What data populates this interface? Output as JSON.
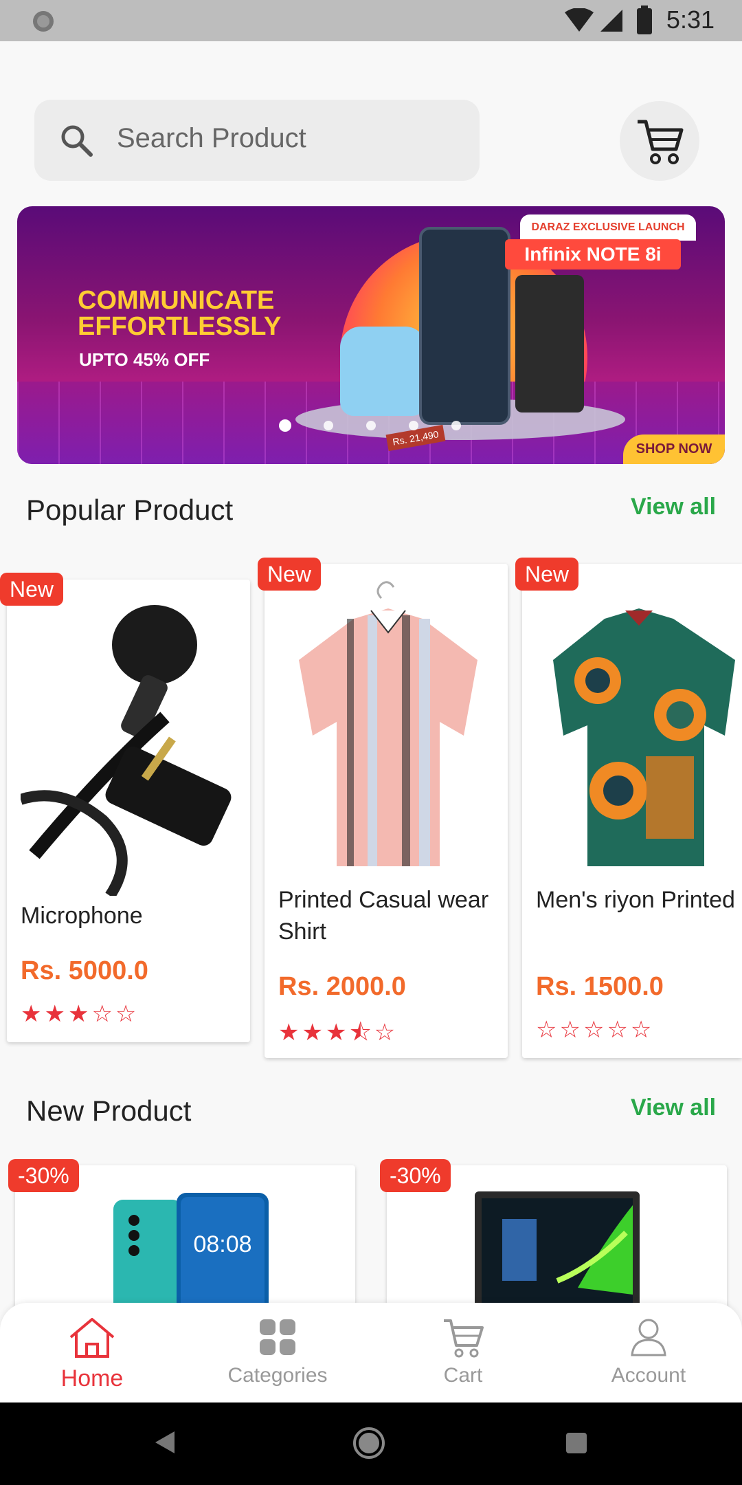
{
  "status_bar": {
    "time": "5:31"
  },
  "search": {
    "placeholder": "Search Product"
  },
  "banner": {
    "headline": "COMMUNICATE EFFORTLESSLY",
    "subline": "UPTO 45% OFF",
    "tag_top": "DARAZ EXCLUSIVE LAUNCH",
    "tag_brand": "Infinix NOTE 8i",
    "price_tag": "Rs. 21,490",
    "cta": "SHOP NOW",
    "slide_count": 5,
    "active_slide": 1
  },
  "popular": {
    "title": "Popular Product",
    "view_all": "View all",
    "products": [
      {
        "badge": "New",
        "name": "Microphone",
        "price": "Rs. 5000.0",
        "stars": "★★★☆☆",
        "rating": 3
      },
      {
        "badge": "New",
        "name": "Printed Casual wear Shirt",
        "price": "Rs. 2000.0",
        "stars": "★★★⯪☆",
        "rating": 3.5
      },
      {
        "badge": "New",
        "name": "Men's riyon Printed Fabric hap -Sleeve...",
        "price": "Rs. 1500.0",
        "stars": "☆☆☆☆☆",
        "rating": 0
      }
    ]
  },
  "new_products": {
    "title": "New Product",
    "view_all": "View all",
    "products": [
      {
        "badge": "-30%",
        "screen_time": "08:08"
      },
      {
        "badge": "-30%"
      }
    ]
  },
  "bottom_nav": {
    "items": [
      {
        "label": "Home",
        "icon": "home-icon",
        "active": true
      },
      {
        "label": "Categories",
        "icon": "grid-icon",
        "active": false
      },
      {
        "label": "Cart",
        "icon": "cart-icon",
        "active": false
      },
      {
        "label": "Account",
        "icon": "account-icon",
        "active": false
      }
    ]
  },
  "colors": {
    "accent": "#e8333b",
    "price": "#f26a2b",
    "view_all": "#2aa84a",
    "badge": "#ef3b2c"
  }
}
